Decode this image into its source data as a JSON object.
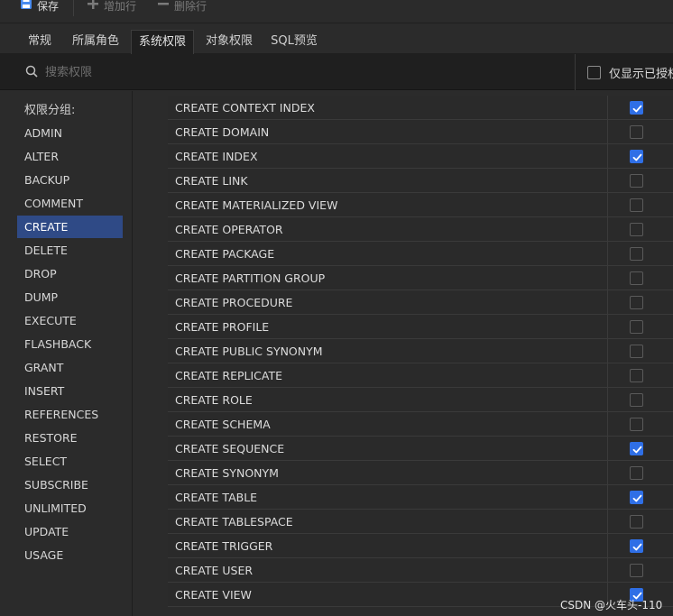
{
  "toolbar": {
    "save_label": "保存",
    "add_row_label": "增加行",
    "delete_row_label": "删除行"
  },
  "tabs": [
    {
      "label": "常规"
    },
    {
      "label": "所属角色"
    },
    {
      "label": "系统权限",
      "active": true
    },
    {
      "label": "对象权限"
    },
    {
      "label": "SQL预览"
    }
  ],
  "search": {
    "placeholder": "搜索权限",
    "show_granted_label": "仅显示已授权",
    "show_granted_checked": false
  },
  "sidebar": {
    "title": "权限分组:",
    "items": [
      {
        "label": "ADMIN"
      },
      {
        "label": "ALTER"
      },
      {
        "label": "BACKUP"
      },
      {
        "label": "COMMENT"
      },
      {
        "label": "CREATE",
        "active": true
      },
      {
        "label": "DELETE"
      },
      {
        "label": "DROP"
      },
      {
        "label": "DUMP"
      },
      {
        "label": "EXECUTE"
      },
      {
        "label": "FLASHBACK"
      },
      {
        "label": "GRANT"
      },
      {
        "label": "INSERT"
      },
      {
        "label": "REFERENCES"
      },
      {
        "label": "RESTORE"
      },
      {
        "label": "SELECT"
      },
      {
        "label": "SUBSCRIBE"
      },
      {
        "label": "UNLIMITED"
      },
      {
        "label": "UPDATE"
      },
      {
        "label": "USAGE"
      }
    ]
  },
  "privileges": [
    {
      "name": "CREATE CONTEXT INDEX",
      "checked": true
    },
    {
      "name": "CREATE DOMAIN",
      "checked": false
    },
    {
      "name": "CREATE INDEX",
      "checked": true
    },
    {
      "name": "CREATE LINK",
      "checked": false
    },
    {
      "name": "CREATE MATERIALIZED VIEW",
      "checked": false
    },
    {
      "name": "CREATE OPERATOR",
      "checked": false
    },
    {
      "name": "CREATE PACKAGE",
      "checked": false
    },
    {
      "name": "CREATE PARTITION GROUP",
      "checked": false
    },
    {
      "name": "CREATE PROCEDURE",
      "checked": false
    },
    {
      "name": "CREATE PROFILE",
      "checked": false
    },
    {
      "name": "CREATE PUBLIC SYNONYM",
      "checked": false
    },
    {
      "name": "CREATE REPLICATE",
      "checked": false
    },
    {
      "name": "CREATE ROLE",
      "checked": false
    },
    {
      "name": "CREATE SCHEMA",
      "checked": false
    },
    {
      "name": "CREATE SEQUENCE",
      "checked": true
    },
    {
      "name": "CREATE SYNONYM",
      "checked": false
    },
    {
      "name": "CREATE TABLE",
      "checked": true
    },
    {
      "name": "CREATE TABLESPACE",
      "checked": false
    },
    {
      "name": "CREATE TRIGGER",
      "checked": true
    },
    {
      "name": "CREATE USER",
      "checked": false
    },
    {
      "name": "CREATE VIEW",
      "checked": true
    }
  ],
  "watermark": "CSDN @火车头-110",
  "colors": {
    "accent": "#2f6fe6",
    "selected_group": "#2f4a86"
  }
}
